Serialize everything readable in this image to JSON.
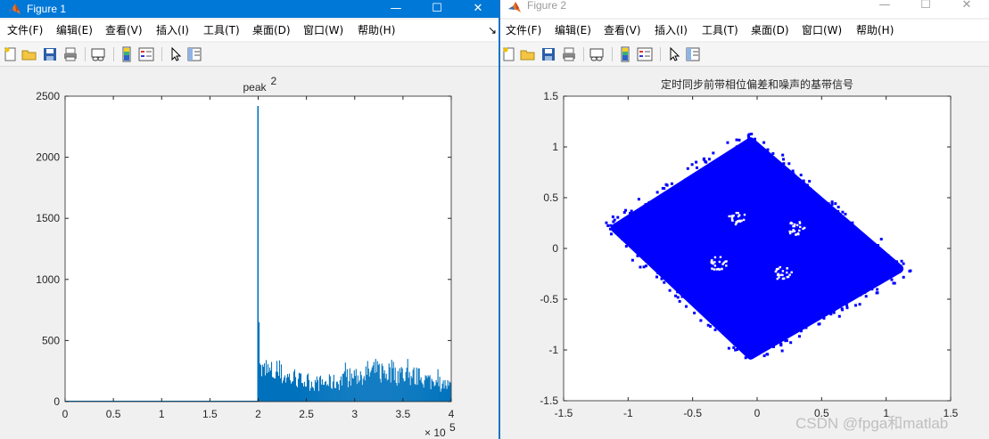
{
  "windows": [
    {
      "title": "Figure 1",
      "controls": {
        "minimize": "—",
        "maximize": "☐",
        "close": "✕"
      },
      "menu": [
        "文件(F)",
        "编辑(E)",
        "查看(V)",
        "插入(I)",
        "工具(T)",
        "桌面(D)",
        "窗口(W)",
        "帮助(H)"
      ],
      "menu_overflow": "↘",
      "toolbar_icons": [
        "new-figure-icon",
        "open-file-icon",
        "save-icon",
        "print-icon",
        "link-plot-icon",
        "colorbar-icon",
        "legend-icon",
        "pointer-icon",
        "property-editor-icon"
      ]
    },
    {
      "title": "Figure 2",
      "controls": {
        "minimize": "—",
        "maximize": "☐",
        "close": "✕"
      },
      "menu": [
        "文件(F)",
        "编辑(E)",
        "查看(V)",
        "插入(I)",
        "工具(T)",
        "桌面(D)",
        "窗口(W)",
        "帮助(H)"
      ],
      "toolbar_icons": [
        "new-figure-icon",
        "open-file-icon",
        "save-icon",
        "print-icon",
        "link-plot-icon",
        "colorbar-icon",
        "legend-icon",
        "pointer-icon",
        "property-editor-icon"
      ]
    }
  ],
  "colors": {
    "series1": "#0072bd",
    "series2": "#0000ff",
    "titlebar_active": "#0078d7",
    "figure_bg": "#f0f0f0"
  },
  "chart_data": [
    {
      "type": "bar",
      "title_base": "peak",
      "title_superscript": "2",
      "xlabel": "",
      "ylabel": "",
      "xlim": [
        0,
        400000
      ],
      "ylim": [
        0,
        2500
      ],
      "x_ticks": [
        "0",
        "0.5",
        "1",
        "1.5",
        "2",
        "2.5",
        "3",
        "3.5",
        "4"
      ],
      "x_exponent_base": "× 10",
      "x_exponent": "5",
      "y_ticks": [
        "0",
        "500",
        "1000",
        "1500",
        "2000",
        "2500"
      ],
      "grid": false,
      "series": [
        {
          "values_description_points": [
            {
              "x": 0,
              "y": 0
            },
            {
              "x": 198000,
              "y": 0
            },
            {
              "x": 200000,
              "y": 2420
            },
            {
              "x": 202000,
              "y": 300
            },
            {
              "x": 220000,
              "y": 280
            },
            {
              "x": 240000,
              "y": 210
            },
            {
              "x": 260000,
              "y": 180
            },
            {
              "x": 280000,
              "y": 190
            },
            {
              "x": 300000,
              "y": 250
            },
            {
              "x": 320000,
              "y": 300
            },
            {
              "x": 340000,
              "y": 290
            },
            {
              "x": 360000,
              "y": 250
            },
            {
              "x": 380000,
              "y": 200
            },
            {
              "x": 400000,
              "y": 150
            }
          ]
        }
      ]
    },
    {
      "type": "scatter",
      "title": "定时同步前带相位偏差和噪声的基带信号",
      "xlabel": "",
      "ylabel": "",
      "xlim": [
        -1.5,
        1.5
      ],
      "ylim": [
        -1.5,
        1.5
      ],
      "x_ticks": [
        "-1.5",
        "-1",
        "-0.5",
        "0",
        "0.5",
        "1",
        "1.5"
      ],
      "y_ticks": [
        "-1.5",
        "-1",
        "-0.5",
        "0",
        "0.5",
        "1",
        "1.5"
      ],
      "grid": false,
      "series": [
        {
          "region_corners": [
            [
              -0.05,
              1.05
            ],
            [
              1.1,
              -0.2
            ],
            [
              -0.05,
              -1.05
            ],
            [
              -1.1,
              0.2
            ]
          ],
          "centroids": [
            [
              -0.15,
              0.3
            ],
            [
              0.3,
              0.2
            ],
            [
              -0.3,
              -0.15
            ],
            [
              0.2,
              -0.25
            ]
          ]
        }
      ]
    }
  ],
  "watermark": "CSDN @fpga和matlab"
}
